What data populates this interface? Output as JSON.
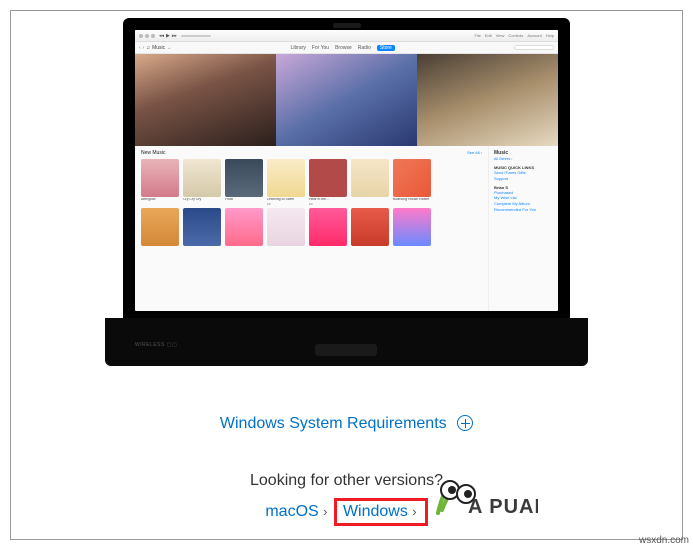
{
  "itunes": {
    "toolbar": {
      "dropdown": "Music",
      "tabs": [
        "Library",
        "For You",
        "Browse",
        "Radio",
        "Store"
      ],
      "active_tab": "Store"
    },
    "titlebar_menu": [
      "File",
      "Edit",
      "View",
      "Controls",
      "Account",
      "Help"
    ],
    "hero": [
      "",
      "",
      ""
    ],
    "section_title": "New Music",
    "see_all": "See All ›",
    "row1": [
      {
        "title": "Afterglow",
        "sub": ""
      },
      {
        "title": "Cry Cry Cry",
        "sub": ""
      },
      {
        "title": "Float",
        "sub": ""
      },
      {
        "title": "Learning to Swim",
        "sub": "EP"
      },
      {
        "title": "Hear in the...",
        "sub": "EP"
      },
      {
        "title": "",
        "sub": ""
      },
      {
        "title": "Boarding House Reach",
        "sub": ""
      }
    ],
    "row2": [
      "",
      "",
      "",
      "",
      "",
      "",
      ""
    ],
    "sidebar": {
      "heading": "Music",
      "sub": "All Genres ›",
      "quick_title": "MUSIC QUICK LINKS",
      "quick": [
        "Send iTunes Gifts",
        "Support"
      ],
      "acct_title": "Brian S",
      "acct": [
        "Purchased",
        "My Wish List",
        "Complete My Album",
        "Recommended For You"
      ]
    }
  },
  "laptop_label": "WIRELESS ▢▢",
  "req_link": "Windows System Requirements",
  "looking": "Looking for other versions?",
  "links": {
    "macos": "macOS",
    "windows": "Windows"
  },
  "chevron": "›",
  "brand": "A PUALS",
  "watermark": "wsxdn.com"
}
